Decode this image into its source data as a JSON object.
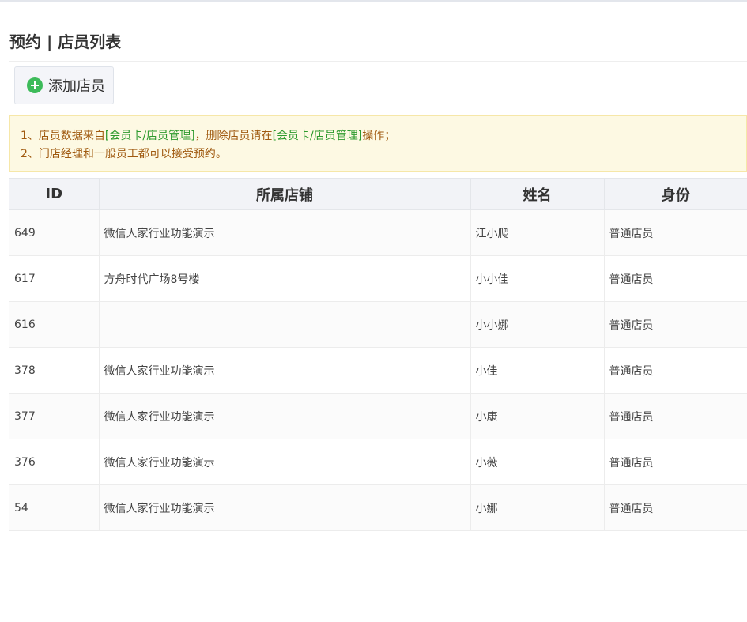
{
  "header": {
    "title": "预约 | 店员列表"
  },
  "toolbar": {
    "add_label": "添加店员",
    "add_icon": "plus-circle-icon",
    "accent_color": "#3dbb5a"
  },
  "notice": {
    "line1_prefix": "1、店员数据来自",
    "line1_link1": "[会员卡/店员管理]",
    "line1_middle": "，删除店员请在",
    "line1_link2": "[会员卡/店员管理]",
    "line1_suffix": "操作；",
    "line2": "2、门店经理和一般员工都可以接受预约。",
    "text_color": "#a05a10",
    "link_color": "#2d9a2d",
    "background": "#fdf9e3"
  },
  "table": {
    "columns": [
      "ID",
      "所属店铺",
      "姓名",
      "身份"
    ],
    "rows": [
      {
        "id": "649",
        "store": "微信人家行业功能演示",
        "name": "江小爬",
        "role": "普通店员"
      },
      {
        "id": "617",
        "store": "方舟时代广场8号楼",
        "name": "小小佳",
        "role": "普通店员"
      },
      {
        "id": "616",
        "store": "",
        "name": "小小娜",
        "role": "普通店员"
      },
      {
        "id": "378",
        "store": "微信人家行业功能演示",
        "name": "小佳",
        "role": "普通店员"
      },
      {
        "id": "377",
        "store": "微信人家行业功能演示",
        "name": "小康",
        "role": "普通店员"
      },
      {
        "id": "376",
        "store": "微信人家行业功能演示",
        "name": "小薇",
        "role": "普通店员"
      },
      {
        "id": "54",
        "store": "微信人家行业功能演示",
        "name": "小娜",
        "role": "普通店员"
      }
    ]
  }
}
